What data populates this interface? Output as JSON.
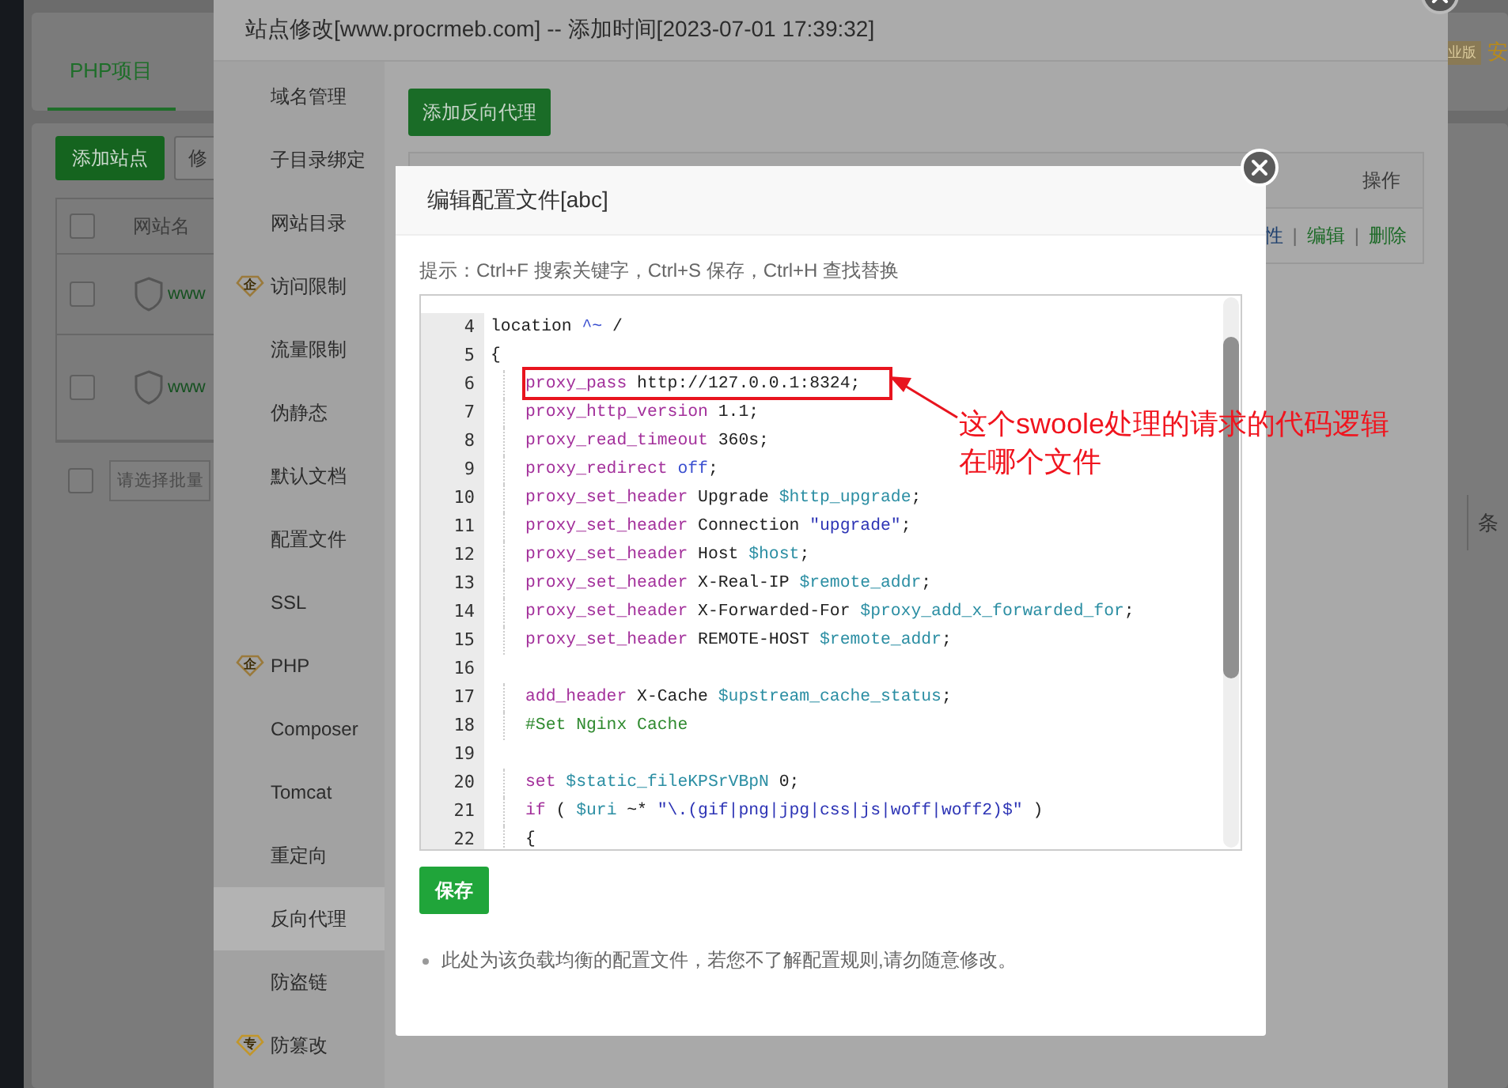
{
  "page": {
    "tab": "PHP项目",
    "buttons": [
      {
        "label": "添加站点",
        "kind": "primary"
      },
      {
        "label": "修",
        "kind": "default"
      }
    ],
    "table": {
      "column": "网站名",
      "header_checkbox": {
        "checked": false
      },
      "rows": [
        {
          "site": "www",
          "checked": false
        },
        {
          "site": "www",
          "checked": false
        }
      ]
    },
    "batch_checkbox": {
      "checked": false
    },
    "batch_placeholder": "请选择批量",
    "edition_badge": "业版",
    "edition_label": "安",
    "pager_text": "条"
  },
  "site_modal": {
    "title": "站点修改[www.procrmeb.com] -- 添加时间[2023-07-01 17:39:32]",
    "sidebar": [
      {
        "label": "域名管理",
        "selected": false
      },
      {
        "label": "子目录绑定",
        "selected": false
      },
      {
        "label": "网站目录",
        "selected": false
      },
      {
        "label": "访问限制",
        "selected": false,
        "badge": "企",
        "color": "#9a7a3c"
      },
      {
        "label": "流量限制",
        "selected": false
      },
      {
        "label": "伪静态",
        "selected": false
      },
      {
        "label": "默认文档",
        "selected": false
      },
      {
        "label": "配置文件",
        "selected": false
      },
      {
        "label": "SSL",
        "selected": false
      },
      {
        "label": "PHP",
        "selected": false,
        "badge": "企",
        "color": "#9a7a3c"
      },
      {
        "label": "Composer",
        "selected": false
      },
      {
        "label": "Tomcat",
        "selected": false
      },
      {
        "label": "重定向",
        "selected": false
      },
      {
        "label": "反向代理",
        "selected": true
      },
      {
        "label": "防盗链",
        "selected": false
      },
      {
        "label": "防篡改",
        "selected": false,
        "badge": "专",
        "color": "#c2962a"
      }
    ],
    "add_button": "添加反向代理",
    "table": {
      "column": "操作",
      "actions": [
        {
          "text": "性",
          "kind": "info"
        },
        {
          "text": "|",
          "kind": "separator"
        },
        {
          "text": "编辑",
          "kind": "link"
        },
        {
          "text": "|",
          "kind": "separator"
        },
        {
          "text": "删除",
          "kind": "link"
        }
      ]
    }
  },
  "editor_modal": {
    "title": "编辑配置文件[abc]",
    "hint": "提示：Ctrl+F 搜索关键字，Ctrl+S 保存，Ctrl+H 查找替换",
    "lines": [
      {
        "number": "4",
        "indented": false,
        "tokens": [
          {
            "kind": "plain",
            "text": "location "
          },
          {
            "kind": "atom",
            "text": "^~"
          },
          {
            "kind": "plain",
            "text": " /"
          }
        ]
      },
      {
        "number": "5",
        "indented": false,
        "tokens": [
          {
            "kind": "plain",
            "text": "{"
          }
        ]
      },
      {
        "number": "6",
        "indented": true,
        "tokens": [
          {
            "kind": "keyword",
            "text": "proxy_pass"
          },
          {
            "kind": "plain",
            "text": " http://127.0.0.1:8324;"
          }
        ]
      },
      {
        "number": "7",
        "indented": true,
        "tokens": [
          {
            "kind": "keyword",
            "text": "proxy_http_version"
          },
          {
            "kind": "plain",
            "text": " 1.1;"
          }
        ]
      },
      {
        "number": "8",
        "indented": true,
        "tokens": [
          {
            "kind": "keyword",
            "text": "proxy_read_timeout"
          },
          {
            "kind": "plain",
            "text": " 360s;"
          }
        ]
      },
      {
        "number": "9",
        "indented": true,
        "tokens": [
          {
            "kind": "keyword",
            "text": "proxy_redirect"
          },
          {
            "kind": "atom",
            "text": " off"
          },
          {
            "kind": "plain",
            "text": ";"
          }
        ]
      },
      {
        "number": "10",
        "indented": true,
        "tokens": [
          {
            "kind": "keyword",
            "text": "proxy_set_header"
          },
          {
            "kind": "plain",
            "text": " Upgrade "
          },
          {
            "kind": "variable",
            "text": "$http_upgrade"
          },
          {
            "kind": "plain",
            "text": ";"
          }
        ]
      },
      {
        "number": "11",
        "indented": true,
        "tokens": [
          {
            "kind": "keyword",
            "text": "proxy_set_header"
          },
          {
            "kind": "plain",
            "text": " Connection "
          },
          {
            "kind": "string",
            "text": "\"upgrade\""
          },
          {
            "kind": "plain",
            "text": ";"
          }
        ]
      },
      {
        "number": "12",
        "indented": true,
        "tokens": [
          {
            "kind": "keyword",
            "text": "proxy_set_header"
          },
          {
            "kind": "plain",
            "text": " Host "
          },
          {
            "kind": "variable",
            "text": "$host"
          },
          {
            "kind": "plain",
            "text": ";"
          }
        ]
      },
      {
        "number": "13",
        "indented": true,
        "tokens": [
          {
            "kind": "keyword",
            "text": "proxy_set_header"
          },
          {
            "kind": "plain",
            "text": " X-Real-IP "
          },
          {
            "kind": "variable",
            "text": "$remote_addr"
          },
          {
            "kind": "plain",
            "text": ";"
          }
        ]
      },
      {
        "number": "14",
        "indented": true,
        "tokens": [
          {
            "kind": "keyword",
            "text": "proxy_set_header"
          },
          {
            "kind": "plain",
            "text": " X-Forwarded-For "
          },
          {
            "kind": "variable",
            "text": "$proxy_add_x_forwarded_for"
          },
          {
            "kind": "plain",
            "text": ";"
          }
        ]
      },
      {
        "number": "15",
        "indented": true,
        "tokens": [
          {
            "kind": "keyword",
            "text": "proxy_set_header"
          },
          {
            "kind": "plain",
            "text": " REMOTE-HOST "
          },
          {
            "kind": "variable",
            "text": "$remote_addr"
          },
          {
            "kind": "plain",
            "text": ";"
          }
        ]
      },
      {
        "number": "16",
        "indented": false
      },
      {
        "number": "17",
        "indented": true,
        "tokens": [
          {
            "kind": "keyword",
            "text": "add_header"
          },
          {
            "kind": "plain",
            "text": " X-Cache "
          },
          {
            "kind": "variable",
            "text": "$upstream_cache_status"
          },
          {
            "kind": "plain",
            "text": ";"
          }
        ]
      },
      {
        "number": "18",
        "indented": true,
        "tokens": [
          {
            "kind": "comment",
            "text": "#Set Nginx Cache"
          }
        ]
      },
      {
        "number": "19",
        "indented": false
      },
      {
        "number": "20",
        "indented": true,
        "tokens": [
          {
            "kind": "keyword",
            "text": "set"
          },
          {
            "kind": "variable",
            "text": " $static_fileKPSrVBpN"
          },
          {
            "kind": "plain",
            "text": " 0;"
          }
        ]
      },
      {
        "number": "21",
        "indented": true,
        "tokens": [
          {
            "kind": "keyword",
            "text": "if"
          },
          {
            "kind": "plain",
            "text": " ( "
          },
          {
            "kind": "variable",
            "text": "$uri"
          },
          {
            "kind": "plain",
            "text": " ~* "
          },
          {
            "kind": "string",
            "text": "\"\\.(gif|png|jpg|css|js|woff|woff2)$\""
          },
          {
            "kind": "plain",
            "text": " )"
          }
        ]
      },
      {
        "number": "22",
        "indented": true,
        "tokens": [
          {
            "kind": "plain",
            "text": "{"
          }
        ]
      }
    ],
    "save_button": "保存",
    "note": "此处为该负载均衡的配置文件，若您不了解配置规则,请勿随意修改。"
  },
  "annotation": {
    "text": "这个swoole处理的请求的代码逻辑在哪个文件"
  }
}
